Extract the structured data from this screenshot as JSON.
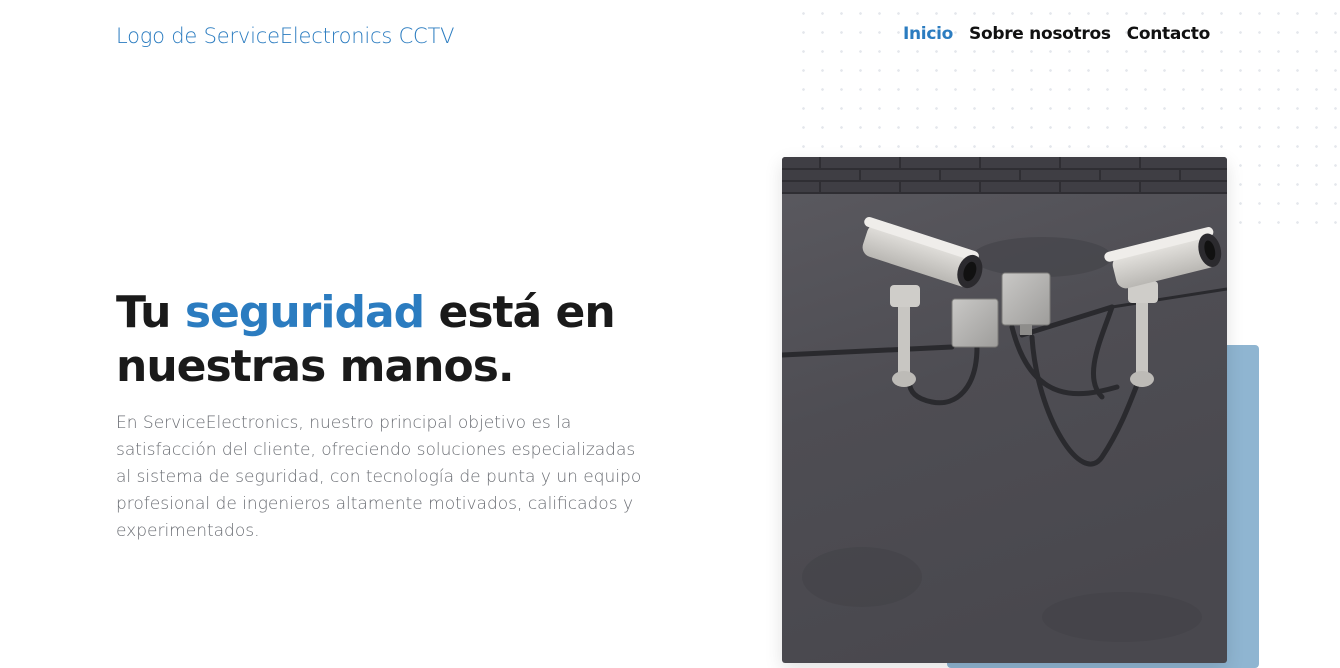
{
  "header": {
    "logo_text": "Logo de ServiceElectronics CCTV",
    "nav": [
      {
        "label": "Inicio",
        "active": true
      },
      {
        "label": "Sobre nosotros",
        "active": false
      },
      {
        "label": "Contacto",
        "active": false
      }
    ]
  },
  "hero": {
    "title_part1": "Tu ",
    "title_accent": "seguridad",
    "title_part2": " está en nuestras manos.",
    "description": "En ServiceElectronics, nuestro principal objetivo es la satisfacción del cliente, ofreciendo soluciones especializadas al sistema de seguridad, con tecnología de punta y un equipo profesional de ingenieros altamente motivados, calificados y experimentados."
  },
  "image": {
    "subject": "cctv-cameras-on-wall"
  },
  "colors": {
    "accent": "#2b7cc0",
    "accent_block": "#8fb5d1",
    "text_dark": "#1a1a1a",
    "text_muted": "#6b6e74"
  }
}
